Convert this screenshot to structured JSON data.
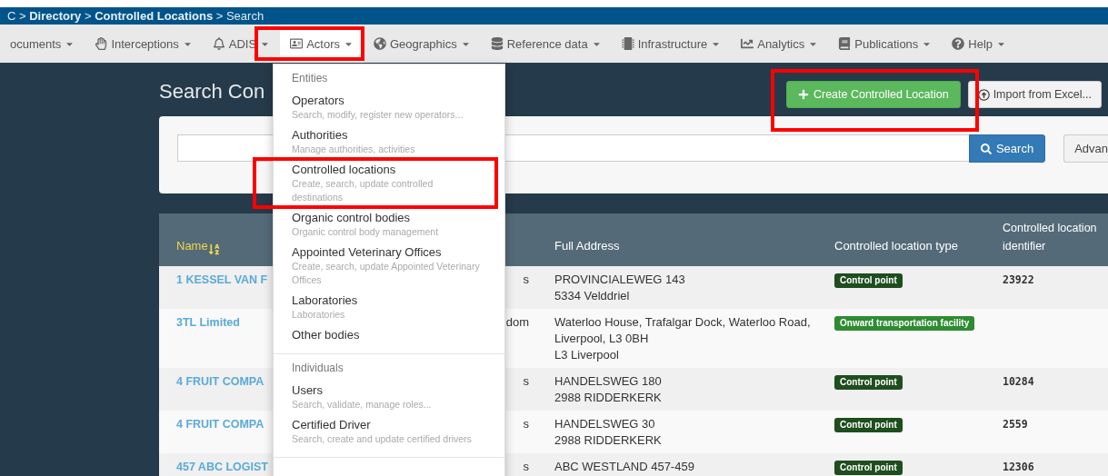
{
  "breadcrumb": "C > **Directory** > **Controlled Locations** > Search",
  "nav": [
    {
      "label": "ocuments",
      "selected": false
    },
    {
      "label": "Interceptions",
      "selected": false
    },
    {
      "label": "ADIS",
      "selected": false
    },
    {
      "label": "Actors",
      "selected": true
    },
    {
      "label": "Geographics",
      "selected": false
    },
    {
      "label": "Reference data",
      "selected": false
    },
    {
      "label": "Infrastructure",
      "selected": false
    },
    {
      "label": "Analytics",
      "selected": false
    },
    {
      "label": "Publications",
      "selected": false
    },
    {
      "label": "Help",
      "selected": false
    }
  ],
  "page_title": "Search Con",
  "actions": {
    "create": "Create Controlled Location",
    "import": "Import from Excel..."
  },
  "search": {
    "button": "Search",
    "advanced": "Advan"
  },
  "table": {
    "columns": [
      "Name",
      "Full Address",
      "Controlled location type",
      "Controlled location identifier"
    ],
    "rows": [
      {
        "name": "1 KESSEL VAN F",
        "column_2": "s",
        "address": [
          "PROVINCIALEWEG 143",
          "5334 Velddriel"
        ],
        "type": {
          "label": "Control point",
          "color": "#1e4d1e"
        },
        "identifier": "23922"
      },
      {
        "name": "3TL Limited",
        "column_2": "dom",
        "address": [
          "Waterloo House, Trafalgar Dock, Waterloo Road,",
          "Liverpool, L3 0BH",
          "L3 Liverpool"
        ],
        "type": {
          "label": "Onward transportation facility",
          "color": "#2e8b32"
        }
      },
      {
        "name": "4 FRUIT COMPA",
        "column_2": "s",
        "address": [
          "HANDELSWEG 180",
          "2988 RIDDERKERK"
        ],
        "type": {
          "label": "Control point",
          "color": "#1e4d1e"
        },
        "identifier": "10284"
      },
      {
        "name": "4 FRUIT COMPA",
        "column_2": "s",
        "address": [
          "HANDELSWEG 30",
          "2988 RIDDERKERK"
        ],
        "type": {
          "label": "Control point",
          "color": "#1e4d1e"
        },
        "identifier": "2559"
      },
      {
        "name": "457 ABC LOGIST",
        "column_2": "s",
        "address": [
          "ABC WESTLAND 457-459"
        ],
        "type": {
          "label": "Control point",
          "color": "#1e4d1e"
        },
        "identifier": "12306"
      }
    ]
  },
  "menu": {
    "sections": [
      {
        "header": "Entities",
        "items": [
          {
            "title": "Operators",
            "description": "Search, modify, register new operators..."
          },
          {
            "title": "Authorities",
            "description": "Manage authorities, activities"
          },
          {
            "title": "Controlled locations",
            "description": "Create, search, update controlled destinations"
          },
          {
            "title": "Organic control bodies",
            "description": "Organic control body management"
          },
          {
            "title": "Appointed Veterinary Offices",
            "description": "Create, search, update Appointed Veterinary Offices"
          },
          {
            "title": "Laboratories",
            "description": "Laboratories"
          },
          {
            "title": "Other bodies"
          }
        ]
      },
      {
        "header": "Individuals",
        "items": [
          {
            "title": "Users",
            "description": "Search, validate, manage roles..."
          },
          {
            "title": "Certified Driver",
            "description": "Search, create and update certified drivers"
          }
        ]
      }
    ]
  }
}
